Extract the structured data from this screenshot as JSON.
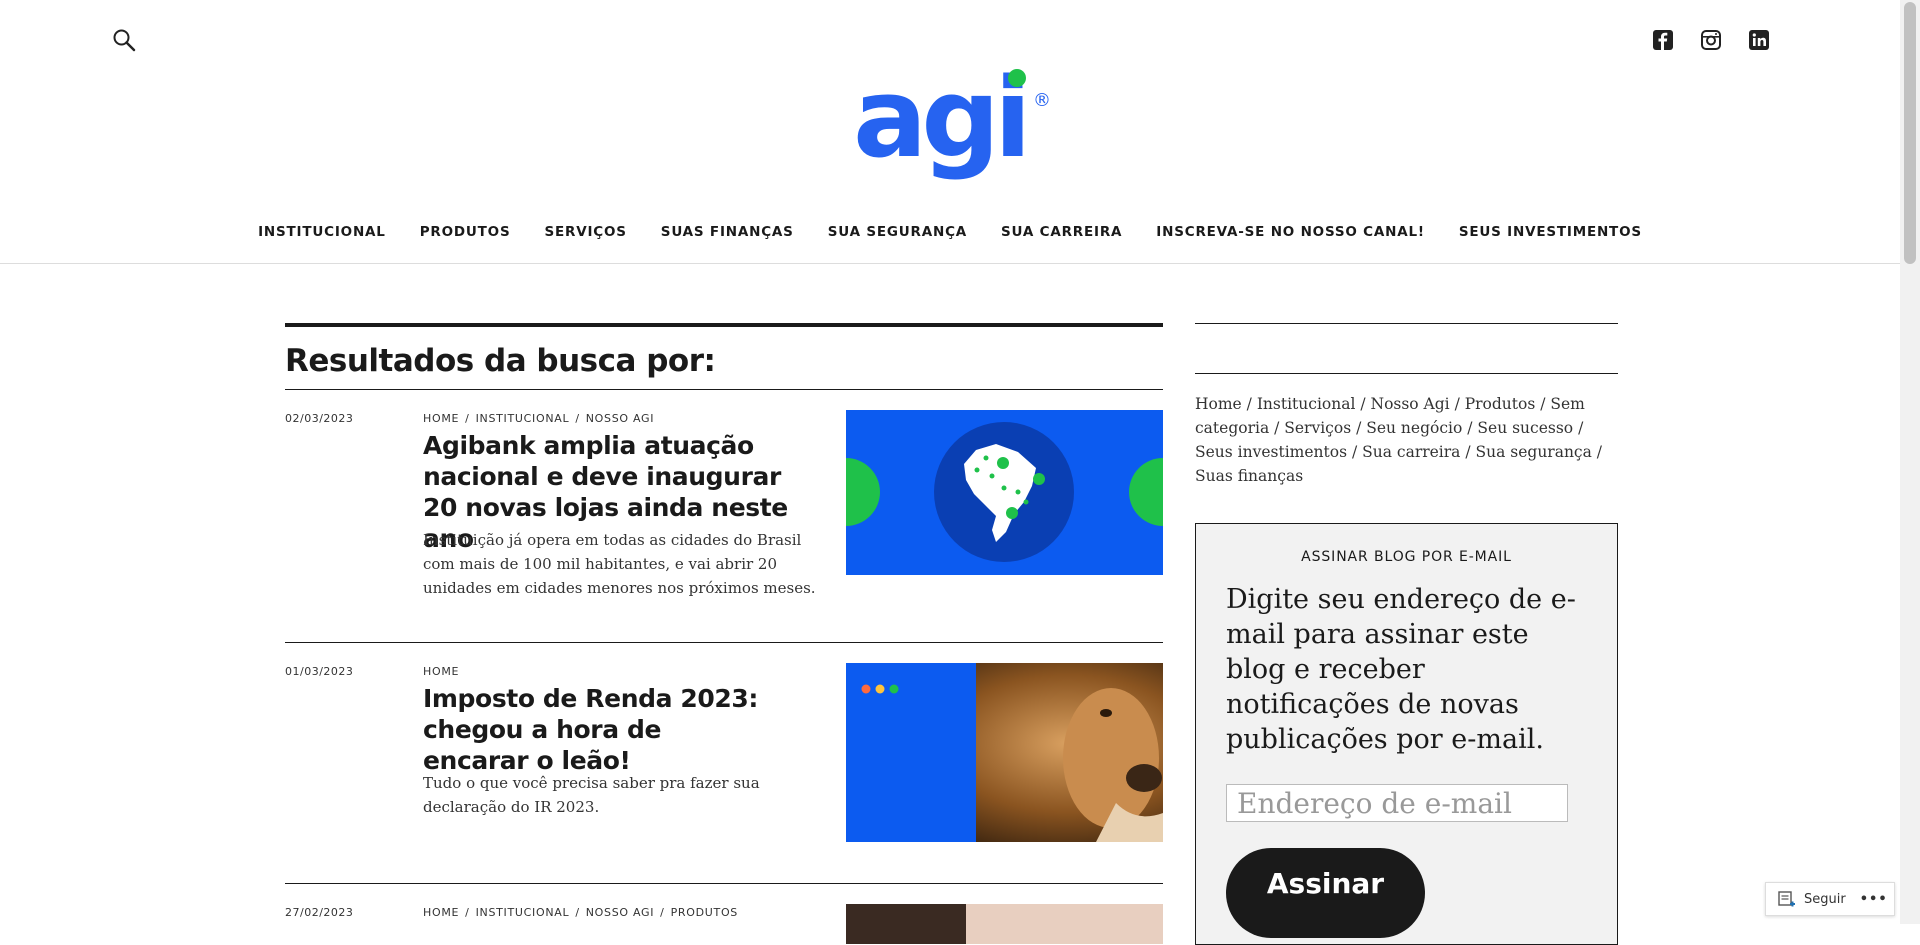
{
  "header": {
    "logo_text": "agi",
    "registered_mark": "®",
    "social": [
      "facebook-icon",
      "instagram-icon",
      "linkedin-icon"
    ]
  },
  "nav": {
    "items": [
      "INSTITUCIONAL",
      "PRODUTOS",
      "SERVIÇOS",
      "SUAS FINANÇAS",
      "SUA SEGURANÇA",
      "SUA CARREIRA",
      "INSCREVA-SE NO NOSSO CANAL!",
      "SEUS INVESTIMENTOS"
    ]
  },
  "main": {
    "title": "Resultados da busca por:",
    "posts": [
      {
        "date": "02/03/2023",
        "categories": [
          "HOME",
          "INSTITUCIONAL",
          "NOSSO AGI"
        ],
        "title": "Agibank amplia atuação nacional e deve inaugurar 20 novas lojas ainda neste ano",
        "excerpt": "Instituição já opera em todas as cidades do Brasil com mais de 100 mil habitantes, e vai abrir 20 unidades em cidades menores nos próximos meses."
      },
      {
        "date": "01/03/2023",
        "categories": [
          "HOME"
        ],
        "title": "Imposto de Renda 2023: chegou a hora de encarar o leão!",
        "excerpt": "Tudo o que você precisa saber pra fazer sua declaração do IR 2023."
      },
      {
        "date": "27/02/2023",
        "categories": [
          "HOME",
          "INSTITUCIONAL",
          "NOSSO AGI",
          "PRODUTOS"
        ]
      }
    ]
  },
  "sidebar": {
    "crumbs": [
      "Home",
      "Institucional",
      "Nosso Agi",
      "Produtos",
      "Sem categoria",
      "Serviços",
      "Seu negócio",
      "Seu sucesso",
      "Seus investimentos",
      "Sua carreira",
      "Sua segurança",
      "Suas finanças"
    ],
    "subscribe": {
      "heading": "ASSINAR BLOG POR E-MAIL",
      "description": "Digite seu endereço de e-mail para assinar este blog e receber notificações de novas publicações por e-mail.",
      "email_placeholder": "Endereço de e-mail",
      "button_label": "Assinar"
    }
  },
  "follow": {
    "label": "Seguir",
    "more": "•••"
  },
  "colors": {
    "brand_blue": "#2663f0",
    "brand_green": "#1fc14a",
    "thumb_blue": "#0c5bf0",
    "dark": "#1a1a1a"
  }
}
